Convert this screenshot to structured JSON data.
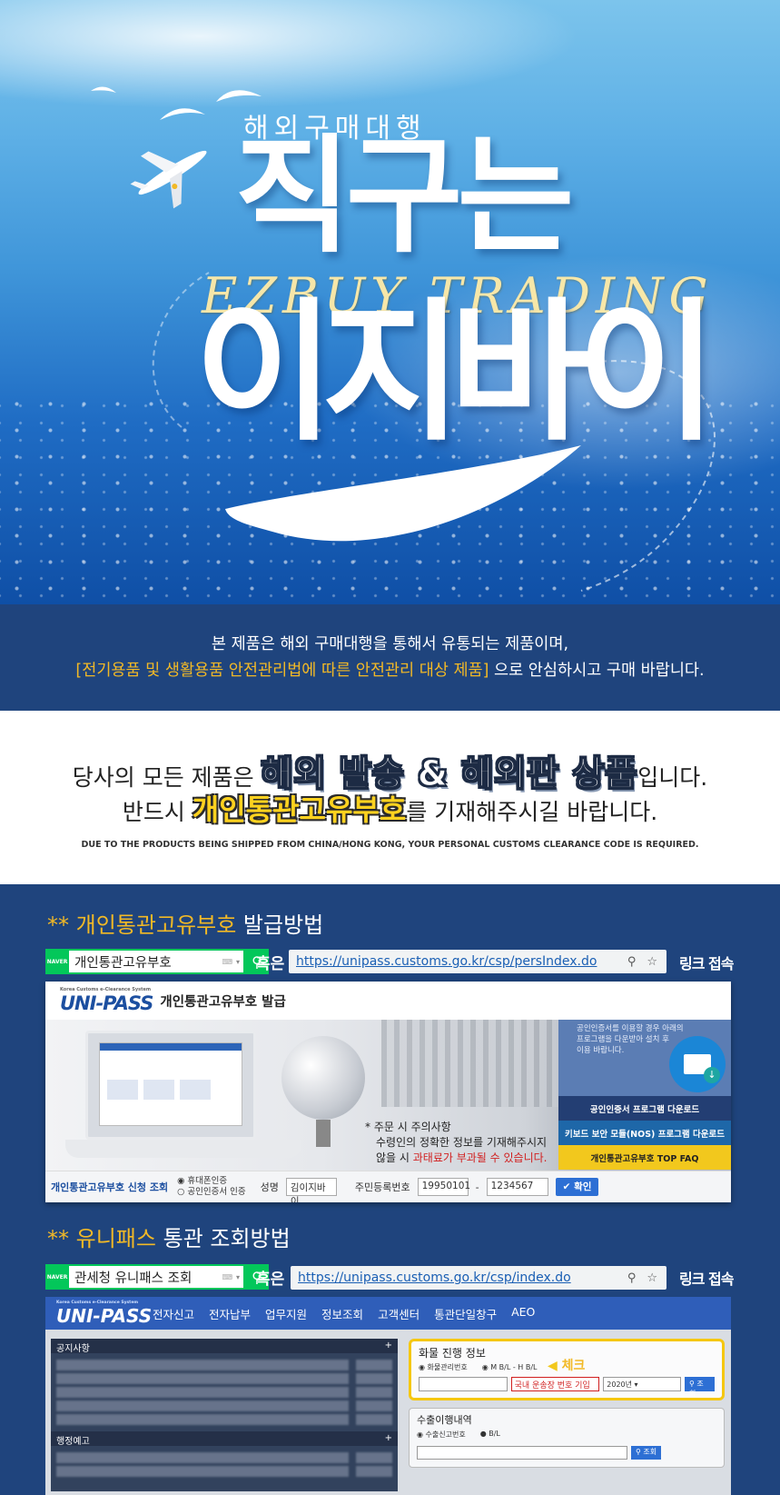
{
  "hero": {
    "subtitle": "해외구매대행",
    "title_line1": "직구는",
    "english": "EZBUY TRADING",
    "title_line2": "이지바이"
  },
  "notice": {
    "line1": "본 제품은 해외 구매대행을 통해서 유통되는 제품이며,",
    "line2_highlight": "[전기용품 및 생활용품 안전관리법에 따른 안전관리 대상 제품]",
    "line2_rest": " 으로 안심하시고 구매 바랍니다."
  },
  "shipping": {
    "l1_pre": "당사의 모든 제품은 ",
    "l1_big": "해외 발송 & 해외판 상품",
    "l1_post": "입니다.",
    "l2_pre": "반드시 ",
    "l2_big": "개인통관고유부호",
    "l2_post": "를 기재해주시길 바랍니다.",
    "english": "DUE TO THE PRODUCTS BEING SHIPPED FROM CHINA/HONG KONG, YOUR PERSONAL CUSTOMS CLEARANCE CODE IS REQUIRED."
  },
  "guide1": {
    "stars": "** ",
    "title_yellow": "개인통관고유부호",
    "title_rest": " 발급방법",
    "naver": "NAVER",
    "search_text": "개인통관고유부호",
    "or": "혹은",
    "url": "https://unipass.customs.go.kr/csp/persIndex.do",
    "link_go": "링크 접속"
  },
  "panel1": {
    "logo": "UNI-PASS",
    "logo_tiny": "Korea Customs e-Clearance System",
    "title": "개인통관고유부호 발급",
    "caution_title": "* 주문 시 주의사항",
    "caution_l1": "수령인의 정확한 정보를 기재해주시지",
    "caution_l2_pre": "않을 시 ",
    "caution_l2_red": "과태료가 부과될 수 있습니다.",
    "rc_text_l1": "공인인증서를 이용할 경우 아래의",
    "rc_text_l2": "프로그램을 다운받아 설치 후",
    "rc_text_l3": "이용 바랍니다.",
    "btn1": "공인인증서 프로그램 다운로드",
    "btn2": "키보드 보안 모듈(NOS) 프로그램 다운로드",
    "btn3": "개인통관고유부호 TOP FAQ",
    "form_label": "개인통관고유부호 신청 조회",
    "radio1": "휴대폰인증",
    "radio2": "공인인증서 인증",
    "name_label": "성명",
    "name_value": "김이지바이",
    "rrn_label": "주민등록번호",
    "rrn1": "19950101",
    "rrn2": "1234567",
    "ok_btn": "확인"
  },
  "guide2": {
    "stars": "** ",
    "title_yellow": "유니패스",
    "title_rest": " 통관 조회방법",
    "naver": "NAVER",
    "search_text": "관세청 유니패스 조회",
    "or": "혹은",
    "url": "https://unipass.customs.go.kr/csp/index.do",
    "link_go": "링크 접속"
  },
  "panel2": {
    "logo": "UNI-PASS",
    "logo_tiny": "Korea Customs e-Clearance System",
    "menu": [
      "전자신고",
      "전자납부",
      "업무지원",
      "정보조회",
      "고객센터",
      "통관단일창구",
      "AEO"
    ],
    "notice_title": "공지사항",
    "press_title": "행정예고",
    "cargo_title": "화물 진행 정보",
    "opt1": "화물관리번호",
    "opt2": "M B/L - H B/L",
    "check": "체크",
    "invoice_hint": "국내 운송장 번호 기입",
    "year": "2020년",
    "search_btn": "조회",
    "export_title": "수출이행내역",
    "exp_opt1": "수출신고번호",
    "exp_opt2": "B/L",
    "exp_btn": "조회"
  },
  "colors": {
    "navy": "#1f447d",
    "yellow": "#f2b926",
    "naver_green": "#03c75a",
    "unipass_blue": "#2f5eb9"
  }
}
